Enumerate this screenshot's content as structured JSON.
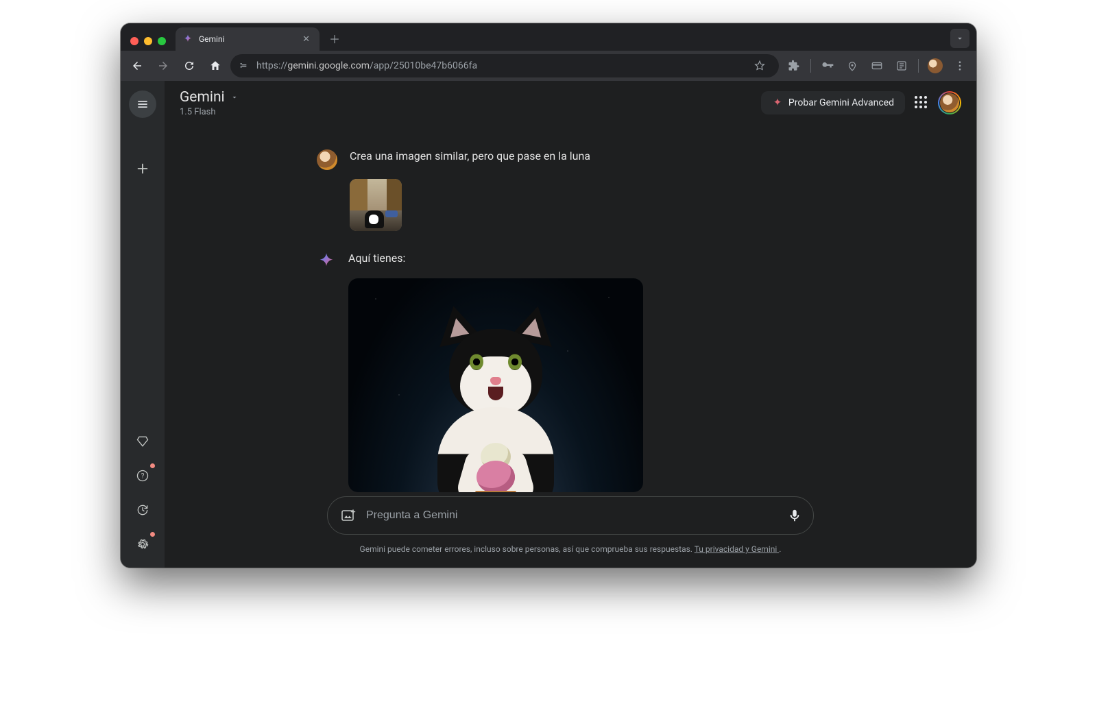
{
  "browser": {
    "tab_title": "Gemini",
    "url_scheme": "https://",
    "url_host": "gemini.google.com",
    "url_path": "/app/25010be47b6066fa"
  },
  "header": {
    "title": "Gemini",
    "subtitle": "1.5 Flash",
    "cta_label": "Probar Gemini Advanced"
  },
  "conversation": {
    "user_prompt": "Crea una imagen similar, pero que pase en la luna",
    "assistant_intro": "Aquí tienes:"
  },
  "input": {
    "placeholder": "Pregunta a Gemini"
  },
  "footer": {
    "disclaimer_text": "Gemini puede cometer errores, incluso sobre personas, así que comprueba sus respuestas. ",
    "privacy_link_text": "Tu privacidad y Gemini ",
    "trailing": "."
  },
  "colors": {
    "traffic_close": "#ff5f57",
    "traffic_min": "#febc2e",
    "traffic_max": "#28c840",
    "spark_a": "#4285f4",
    "spark_b": "#9b72cb",
    "spark_c": "#d96570",
    "cta_spark": "#d96570"
  }
}
